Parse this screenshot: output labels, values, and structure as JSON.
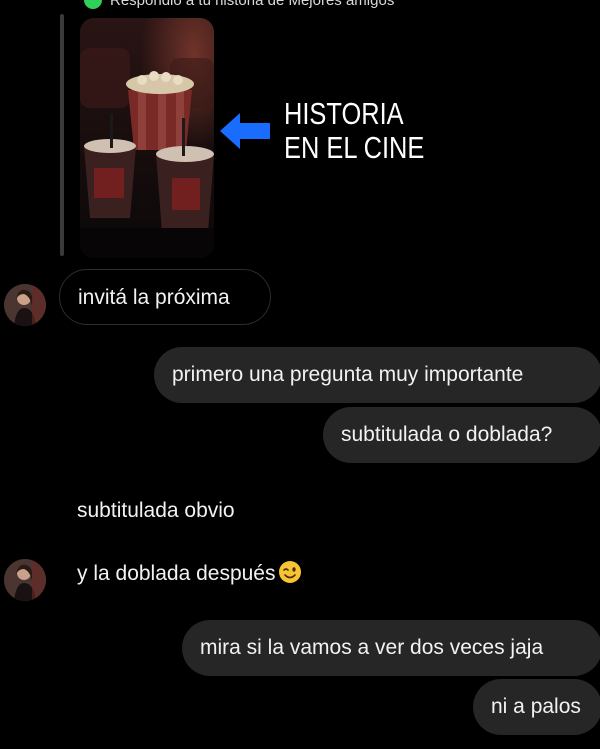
{
  "header": {
    "reply_context": "Respondió a tu historia de Mejores amigos"
  },
  "story": {
    "caption": "HISTORIA\nEN EL CINE",
    "arrow_color": "#1a6cff"
  },
  "colors": {
    "background": "#000000",
    "sent_bubble": "#262626",
    "received_border": "#2c2c2c",
    "text": "#f2f2f2",
    "online_dot": "#2fd15a"
  },
  "messages": [
    {
      "side": "received",
      "text": "invitá la próxima",
      "style": "bubble"
    },
    {
      "side": "sent",
      "text": "primero una pregunta muy importante"
    },
    {
      "side": "sent",
      "text": "subtitulada o doblada?"
    },
    {
      "side": "received",
      "text": "subtitulada obvio",
      "style": "plain"
    },
    {
      "side": "received",
      "text": "y la doblada después",
      "style": "plain",
      "emoji": "winking-face"
    },
    {
      "side": "sent",
      "text": "mira si la vamos a ver dos veces jaja"
    },
    {
      "side": "sent",
      "text": "ni a palos"
    }
  ]
}
